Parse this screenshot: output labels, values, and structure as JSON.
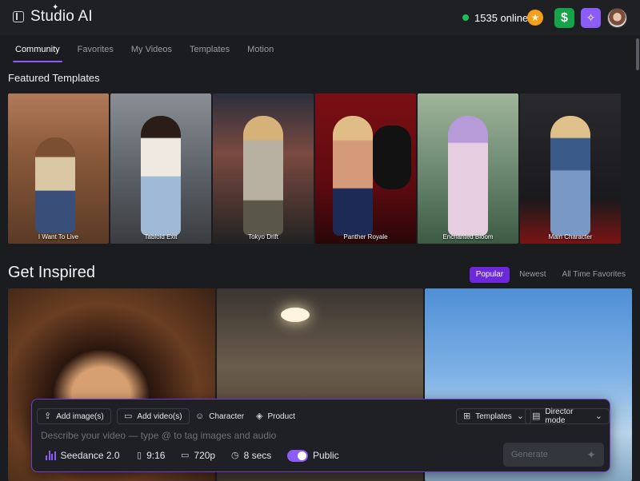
{
  "app": {
    "title": "Studio AI"
  },
  "header": {
    "online_count": "1535 online"
  },
  "tabs": [
    {
      "label": "Community"
    },
    {
      "label": "Favorites"
    },
    {
      "label": "My Videos"
    },
    {
      "label": "Templates"
    },
    {
      "label": "Motion"
    }
  ],
  "featured": {
    "title": "Featured Templates",
    "cards": [
      {
        "label": "I Want To Live"
      },
      {
        "label": "Tabloid Exit"
      },
      {
        "label": "Tokyo Drift"
      },
      {
        "label": "Panther Royale"
      },
      {
        "label": "Enchanted Bloom"
      },
      {
        "label": "Main Character"
      }
    ]
  },
  "inspired": {
    "title": "Get Inspired",
    "filters": [
      {
        "label": "Popular"
      },
      {
        "label": "Newest"
      },
      {
        "label": "All Time Favorites"
      }
    ]
  },
  "composer": {
    "add_images": "Add image(s)",
    "add_videos": "Add video(s)",
    "character": "Character",
    "product": "Product",
    "templates": "Templates",
    "director_mode": "Director mode",
    "placeholder": "Describe your video — type @ to tag images and audio",
    "model": "Seedance 2.0",
    "aspect": "9:16",
    "resolution": "720p",
    "duration": "8 secs",
    "visibility": "Public",
    "generate": "Generate"
  },
  "colors": {
    "accent": "#8b5cf6",
    "online": "#1bbf5a",
    "money": "#17a34a",
    "star": "#f59e1b"
  }
}
